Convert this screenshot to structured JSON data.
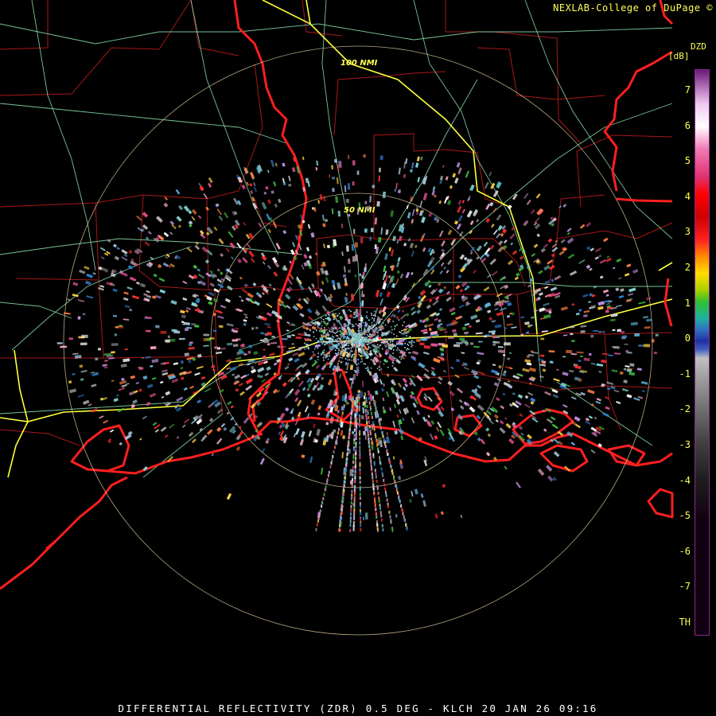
{
  "credit": "NEXLAB-College of DuPage ©",
  "legend": {
    "product": "DZD",
    "unit": "[dB]",
    "ticks": [
      "7",
      "6",
      "5",
      "4",
      "3",
      "2",
      "1",
      "0",
      "-1",
      "-2",
      "-3",
      "-4",
      "-5",
      "-6",
      "-7",
      "TH"
    ]
  },
  "range_rings": [
    {
      "label": "100 NMI",
      "nmi": 100
    },
    {
      "label": "50 NMI",
      "nmi": 50
    }
  ],
  "footer": "DIFFERENTIAL REFLECTIVITY (ZDR) 0.5 DEG - KLCH 20 JAN 26 09:16",
  "colors": {
    "background": "#000000",
    "state_border": "#ff2020",
    "county_border": "#b01818",
    "highways": "#90e8b0",
    "interstate": "#ffff40",
    "range_ring": "#e8d6a0",
    "label": "#ffff55"
  }
}
